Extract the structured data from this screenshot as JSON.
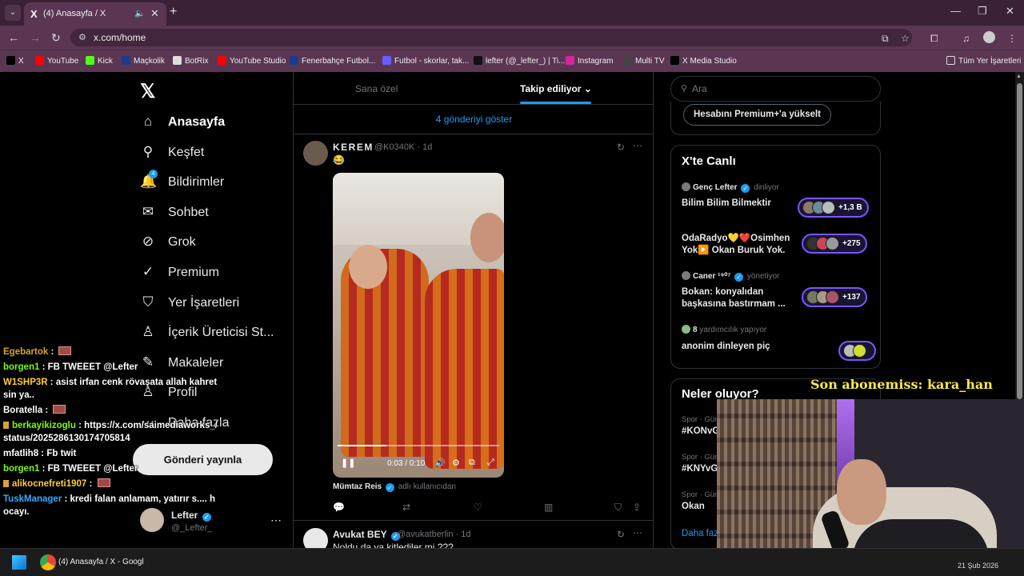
{
  "browser": {
    "tab_title": "(4) Anasayfa / X",
    "tab_favicon": "X",
    "url": "x.com/home",
    "bookmarks": [
      {
        "label": "X",
        "icon": "x-icon",
        "color": "#000000"
      },
      {
        "label": "YouTube",
        "icon": "youtube-icon",
        "color": "#ff0000"
      },
      {
        "label": "Kick",
        "icon": "kick-icon",
        "color": "#53fc18"
      },
      {
        "label": "Maçkolik",
        "icon": "mackolik-icon",
        "color": "#1e3a8a"
      },
      {
        "label": "BotRix",
        "icon": "botrix-icon",
        "color": "#dddddd"
      },
      {
        "label": "YouTube Studio",
        "icon": "youtube-studio-icon",
        "color": "#ff0000"
      },
      {
        "label": "Fenerbahçe Futbol...",
        "icon": "fenerbahce-icon",
        "color": "#1e3a8a"
      },
      {
        "label": "Futbol - skorlar, tak...",
        "icon": "flashscore-icon",
        "color": "#6a5cff"
      },
      {
        "label": "lefter (@_lefter_) | Ti...",
        "icon": "tiktok-icon",
        "color": "#111111"
      },
      {
        "label": "Instagram",
        "icon": "instagram-icon",
        "color": "#d6249f"
      },
      {
        "label": "Multi TV",
        "icon": "multitv-icon",
        "color": "#444444"
      },
      {
        "label": "X Media Studio",
        "icon": "x-icon",
        "color": "#000000"
      }
    ],
    "all_bookmarks": "Tüm Yer İşaretleri"
  },
  "nav": {
    "items": [
      {
        "label": "Anasayfa",
        "icon": "home-icon",
        "glyph": "⌂"
      },
      {
        "label": "Keşfet",
        "icon": "search-icon",
        "glyph": "⚲"
      },
      {
        "label": "Bildirimler",
        "icon": "bell-icon",
        "glyph": "🔔"
      },
      {
        "label": "Sohbet",
        "icon": "mail-icon",
        "glyph": "✉"
      },
      {
        "label": "Grok",
        "icon": "grok-icon",
        "glyph": "⊘"
      },
      {
        "label": "Premium",
        "icon": "premium-icon",
        "glyph": "✓"
      },
      {
        "label": "Yer İşaretleri",
        "icon": "bookmark-icon",
        "glyph": "⛉"
      },
      {
        "label": "İçerik Üreticisi St...",
        "icon": "creator-studio-icon",
        "glyph": "♙"
      },
      {
        "label": "Makaleler",
        "icon": "articles-icon",
        "glyph": "✎"
      },
      {
        "label": "Profil",
        "icon": "profile-icon",
        "glyph": "♙"
      },
      {
        "label": "Daha fazla",
        "icon": "more-icon",
        "glyph": "⋯"
      }
    ],
    "notification_badge": "4",
    "post_button": "Gönderi yayınla",
    "account_name": "Lefter",
    "account_handle": "@_Lefter_"
  },
  "chat": [
    {
      "user": "Egebartok",
      "color": "#d9a23a",
      "text": "",
      "emote": true
    },
    {
      "user": "borgen1",
      "color": "#7cfc00",
      "text": "FB TWEEET @Lefter"
    },
    {
      "user": "W1SHP3R",
      "color": "#ffcc33",
      "text": "asist irfan cenk rövaşata allah kahretsin ya.."
    },
    {
      "user": "Boratella",
      "color": "#ffffff",
      "text": "",
      "emote": true
    },
    {
      "user": "berkayikizoglu",
      "color": "#7cfc00",
      "text": "https://x.com/saimediaworks_/status/2025286130174705814",
      "badge": true
    },
    {
      "user": "mfatlih8",
      "color": "#ffffff",
      "text": "Fb twit"
    },
    {
      "user": "borgen1",
      "color": "#7cfc00",
      "text": "FB TWEEET @Lefter"
    },
    {
      "user": "alikocnefreti1907",
      "color": "#ffcc33",
      "text": "",
      "emote": true,
      "badge": true
    },
    {
      "user": "TuskManager",
      "color": "#3ea6ff",
      "text": "kredi falan anlamam, yatırır s.... hocayı."
    }
  ],
  "feed": {
    "tabs": [
      "Sana özel",
      "Takip ediliyor"
    ],
    "active_tab": "Takip ediliyor",
    "show_posts": "4 gönderiyi göster",
    "post1": {
      "name": "KEREM",
      "handle": "@K0340K",
      "time": "1d",
      "emoji": "😂",
      "video_time": "0:03 / 0:10",
      "video_progress": 0.3,
      "caption_user": "Mümtaz Reis",
      "caption_sub": "adlı kullanıcıdan"
    },
    "post2": {
      "name": "Avukat BEY",
      "handle": "@avukatberlin",
      "time": "1d",
      "text": "Noldu da ya kitlediler mi ???"
    }
  },
  "right": {
    "search_placeholder": "Ara",
    "premium_button": "Hesabını Premium+'a yükselt",
    "live_title": "X'te Canlı",
    "spaces": [
      {
        "host": "Genç Lefter",
        "role": "dinliyor",
        "title": "Bilim Bilim Bilmektir",
        "count": "+1,3 B"
      },
      {
        "host": "",
        "role": "",
        "title": "OdaRadyo💛❤️Osimhen Yok▶️ Okan Buruk Yok.",
        "count": "+275"
      },
      {
        "host": "Caner ¹⁹⁰⁷",
        "role": "yönetiyor",
        "title": "Bokan: konyalıdan başkasına bastırmam ...",
        "count": "+137"
      },
      {
        "host": "8",
        "role": "yardımcılık yapıyor",
        "title": "anonim dinleyen piç",
        "count": ""
      }
    ],
    "trends_title": "Neler oluyor?",
    "trends": [
      {
        "meta": "Spor · Gün",
        "tag": "#KONvG"
      },
      {
        "meta": "Spor · Gün",
        "tag": "#KNYvG"
      },
      {
        "meta": "Spor · Gün",
        "tag": "Okan"
      }
    ],
    "trends_more": "Daha faz"
  },
  "overlay": {
    "sub_banner": "Son abonemiss: kara_han"
  },
  "taskbar": {
    "window_label": "(4) Anasayfa / X - Googl",
    "clock": "21 Şub 2026"
  }
}
